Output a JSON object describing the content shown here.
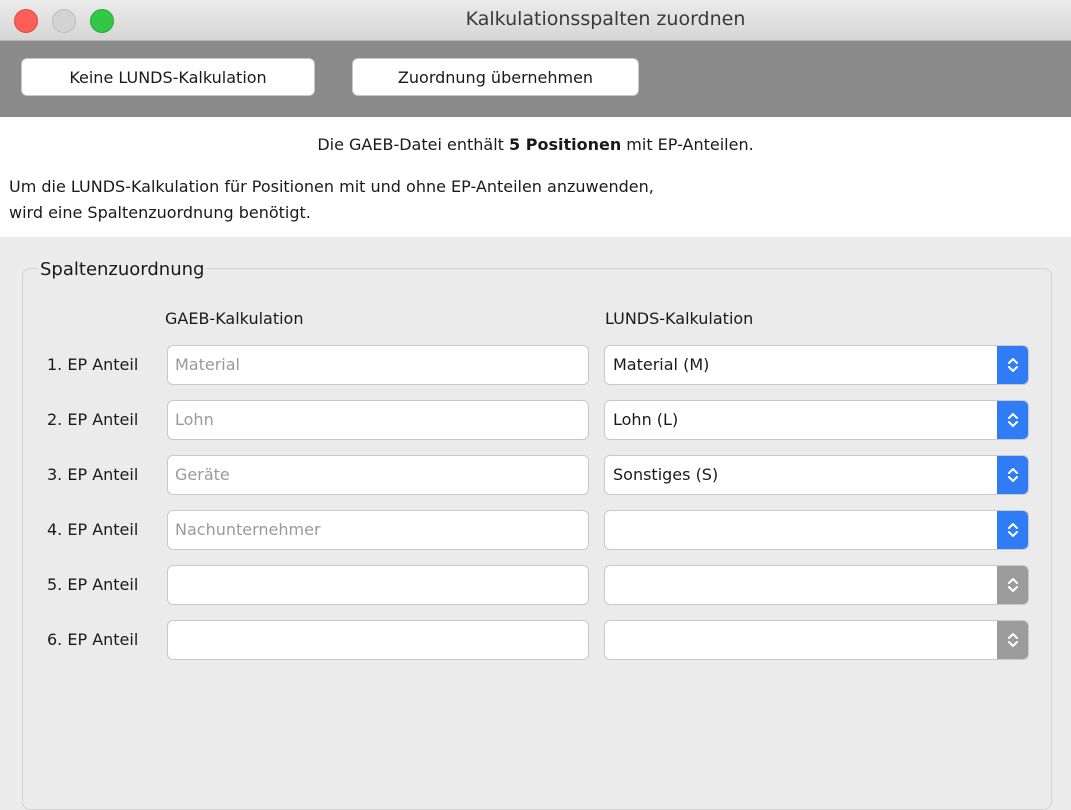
{
  "window": {
    "title": "Kalkulationsspalten zuordnen"
  },
  "toolbar": {
    "no_lunds_label": "Keine LUNDS-Kalkulation",
    "apply_label": "Zuordnung übernehmen"
  },
  "info": {
    "line1_prefix": "Die GAEB-Datei enthält ",
    "line1_bold": "5 Positionen",
    "line1_suffix": " mit EP-Anteilen.",
    "line2": "Um die LUNDS-Kalkulation für Positionen mit und ohne EP-Anteilen anzuwenden,",
    "line3": "wird eine Spaltenzuordnung benötigt."
  },
  "mapping": {
    "group_title": "Spaltenzuordnung",
    "gaeb_header": "GAEB-Kalkulation",
    "lunds_header": "LUNDS-Kalkulation",
    "rows": [
      {
        "label": "1. EP Anteil",
        "gaeb_placeholder": "Material",
        "lunds_value": "Material (M)",
        "enabled": true
      },
      {
        "label": "2. EP Anteil",
        "gaeb_placeholder": "Lohn",
        "lunds_value": "Lohn (L)",
        "enabled": true
      },
      {
        "label": "3. EP Anteil",
        "gaeb_placeholder": "Geräte",
        "lunds_value": "Sonstiges (S)",
        "enabled": true
      },
      {
        "label": "4. EP Anteil",
        "gaeb_placeholder": "Nachunternehmer",
        "lunds_value": "",
        "enabled": true
      },
      {
        "label": "5. EP Anteil",
        "gaeb_placeholder": "",
        "lunds_value": "",
        "enabled": false
      },
      {
        "label": "6. EP Anteil",
        "gaeb_placeholder": "",
        "lunds_value": "",
        "enabled": false
      }
    ]
  },
  "colors": {
    "stepper_active": "#2f7cf6",
    "stepper_inactive": "#9b9b9b",
    "close": "#fc5f57",
    "zoom": "#33c748"
  }
}
